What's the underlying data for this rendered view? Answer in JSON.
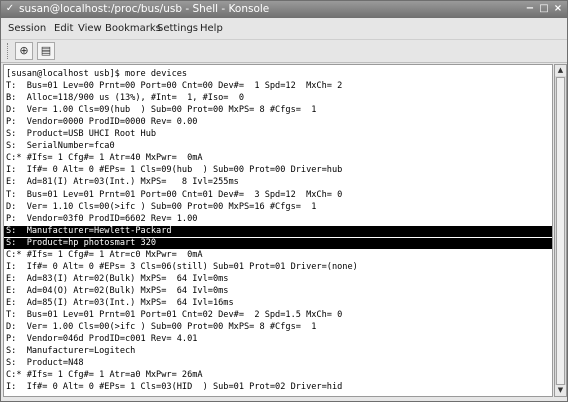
{
  "window": {
    "title": "susan@localhost:/proc/bus/usb - Shell - Konsole",
    "menu_icon": "✓",
    "minimize": "−",
    "maximize": "□",
    "close": "×"
  },
  "menubar": {
    "items": [
      "Session",
      "Edit",
      "View",
      "Bookmarks",
      "Settings",
      "Help"
    ]
  },
  "toolbar": {
    "buttons": [
      {
        "icon": "new-session-icon",
        "glyph": "⊕"
      },
      {
        "icon": "terminal-icon",
        "glyph": "▤"
      }
    ]
  },
  "terminal": {
    "lines": [
      "[susan@localhost usb]$ more devices",
      "T:  Bus=01 Lev=00 Prnt=00 Port=00 Cnt=00 Dev#=  1 Spd=12  MxCh= 2",
      "B:  Alloc=118/900 us (13%), #Int=  1, #Iso=  0",
      "D:  Ver= 1.00 Cls=09(hub  ) Sub=00 Prot=00 MxPS= 8 #Cfgs=  1",
      "P:  Vendor=0000 ProdID=0000 Rev= 0.00",
      "S:  Product=USB UHCI Root Hub",
      "S:  SerialNumber=fca0",
      "C:* #Ifs= 1 Cfg#= 1 Atr=40 MxPwr=  0mA",
      "I:  If#= 0 Alt= 0 #EPs= 1 Cls=09(hub  ) Sub=00 Prot=00 Driver=hub",
      "E:  Ad=81(I) Atr=03(Int.) MxPS=   8 Ivl=255ms",
      "T:  Bus=01 Lev=01 Prnt=01 Port=00 Cnt=01 Dev#=  3 Spd=12  MxCh= 0",
      "D:  Ver= 1.10 Cls=00(>ifc ) Sub=00 Prot=00 MxPS=16 #Cfgs=  1",
      "P:  Vendor=03f0 ProdID=6602 Rev= 1.00",
      "S:  Manufacturer=Hewlett-Packard",
      "S:  Product=hp photosmart 320",
      "C:* #Ifs= 1 Cfg#= 1 Atr=c0 MxPwr=  0mA",
      "I:  If#= 0 Alt= 0 #EPs= 3 Cls=06(still) Sub=01 Prot=01 Driver=(none)",
      "E:  Ad=83(I) Atr=02(Bulk) MxPS=  64 Ivl=0ms",
      "E:  Ad=04(O) Atr=02(Bulk) MxPS=  64 Ivl=0ms",
      "E:  Ad=85(I) Atr=03(Int.) MxPS=  64 Ivl=16ms",
      "T:  Bus=01 Lev=01 Prnt=01 Port=01 Cnt=02 Dev#=  2 Spd=1.5 MxCh= 0",
      "D:  Ver= 1.00 Cls=00(>ifc ) Sub=00 Prot=00 MxPS= 8 #Cfgs=  1",
      "P:  Vendor=046d ProdID=c001 Rev= 4.01",
      "S:  Manufacturer=Logitech",
      "S:  Product=N48",
      "C:* #Ifs= 1 Cfg#= 1 Atr=a0 MxPwr= 26mA",
      "I:  If#= 0 Alt= 0 #EPs= 1 Cls=03(HID  ) Sub=01 Prot=02 Driver=hid"
    ],
    "highlighted": [
      13,
      14
    ]
  },
  "scrollbar": {
    "up_arrow": "▲",
    "down_arrow": "▼"
  }
}
